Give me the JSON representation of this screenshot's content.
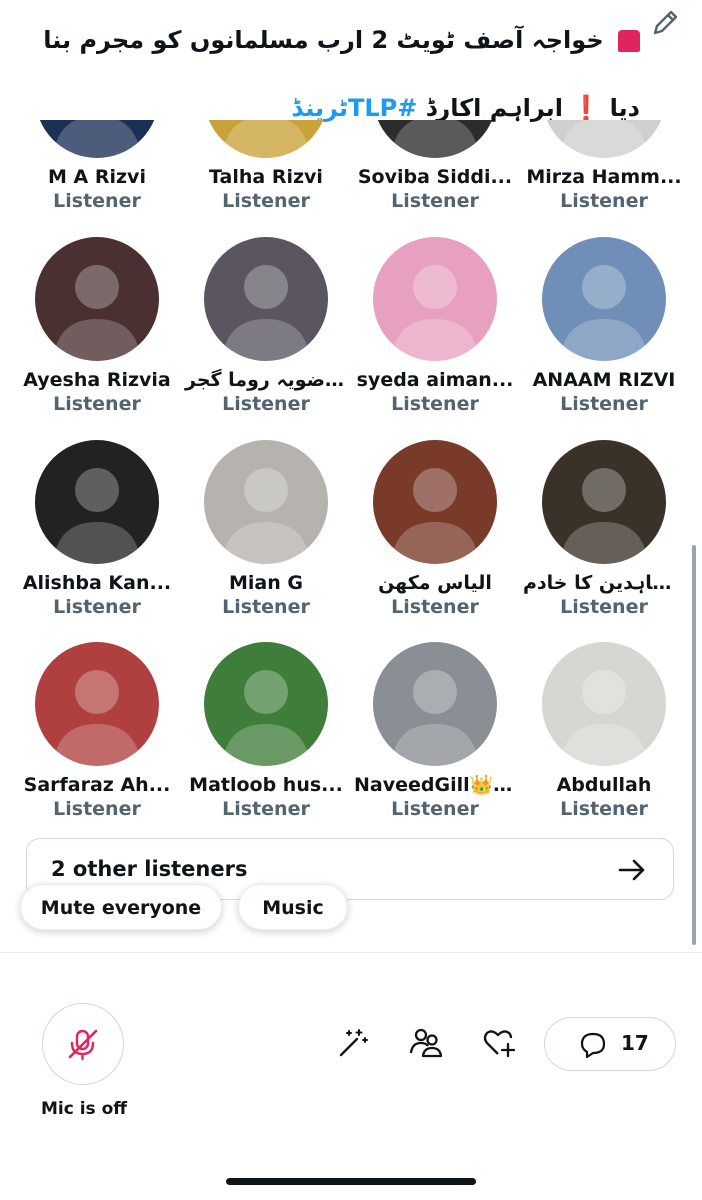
{
  "title": {
    "part1": "خواجہ آصف ٹویٹ 2 ارب مسلمانوں کو مجرم بنا دیا",
    "part2": "ابراہم اکارڈ",
    "hashtag": "#TLPٹرینڈ"
  },
  "listeners": [
    {
      "name": "M A Rizvi",
      "role": "Listener",
      "bg": "#1c2f55"
    },
    {
      "name": "Talha Rizvi",
      "role": "Listener",
      "bg": "#c9a23a"
    },
    {
      "name": "Soviba Siddi...",
      "role": "Listener",
      "bg": "#2c2c2c"
    },
    {
      "name": "Mirza Hamm...",
      "role": "Listener",
      "bg": "#cfcfcf"
    },
    {
      "name": "Ayesha Rizvia",
      "role": "Listener",
      "bg": "#4a3030"
    },
    {
      "name": "رضویہ روما گجر ⚔️",
      "role": "Listener",
      "bg": "#5a5560"
    },
    {
      "name": "syeda aiman...",
      "role": "Listener",
      "bg": "#e8a0c0"
    },
    {
      "name": "ANAAM RIZVI",
      "role": "Listener",
      "bg": "#6f8fb8"
    },
    {
      "name": "Alishba Kan...",
      "role": "Listener",
      "bg": "#222222"
    },
    {
      "name": "Mian G",
      "role": "Listener",
      "bg": "#b6b3ae"
    },
    {
      "name": "الیاس مکھن",
      "role": "Listener",
      "bg": "#7a3a2a"
    },
    {
      "name": "امیر المجاہدین کا خادم",
      "role": "Listener",
      "bg": "#3a3228"
    },
    {
      "name": "Sarfaraz Ah...",
      "role": "Listener",
      "bg": "#b04040"
    },
    {
      "name": "Matloob hus...",
      "role": "Listener",
      "bg": "#3f7d3a"
    },
    {
      "name": "NaveedGill👑 🇵🇰",
      "role": "Listener",
      "bg": "#8a8f95"
    },
    {
      "name": "Abdullah",
      "role": "Listener",
      "bg": "#d8d6d2"
    }
  ],
  "others": {
    "label": "2 other listeners"
  },
  "chips": {
    "mute": "Mute everyone",
    "music": "Music"
  },
  "mic": {
    "label": "Mic is off"
  },
  "comments": {
    "count": "17"
  },
  "colors": {
    "accent": "#e0245e",
    "link": "#1d9bf0",
    "muted": "#536471"
  }
}
